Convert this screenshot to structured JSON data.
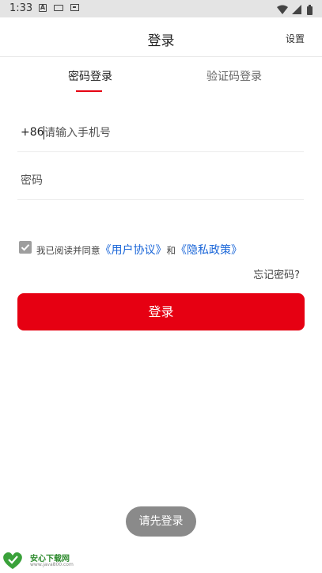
{
  "status_bar": {
    "time": "1:33",
    "icons": [
      "a-icon",
      "keyboard-icon",
      "sim-card-icon",
      "wifi-icon",
      "signal-icon",
      "battery-icon"
    ]
  },
  "header": {
    "title": "登录",
    "settings_label": "设置"
  },
  "tabs": [
    {
      "label": "密码登录",
      "active": true
    },
    {
      "label": "验证码登录",
      "active": false
    }
  ],
  "form": {
    "country_code": "+86",
    "phone_placeholder": "请输入手机号",
    "phone_value": "",
    "password_placeholder": "密码",
    "password_value": ""
  },
  "agreement": {
    "checked": true,
    "prefix_text": "我已阅读并同意",
    "user_agreement": "《用户协议》",
    "and_text": "和",
    "privacy_policy": "《隐私政策》"
  },
  "forgot_password": "忘记密码?",
  "login_button": "登录",
  "toast": "请先登录",
  "watermark": {
    "title": "安心下载网",
    "url": "www.java800.com"
  },
  "colors": {
    "accent": "#e60012",
    "link": "#1a66d8",
    "toast_bg": "#8a8a8a",
    "status_bar_bg": "#e4e4e4"
  }
}
